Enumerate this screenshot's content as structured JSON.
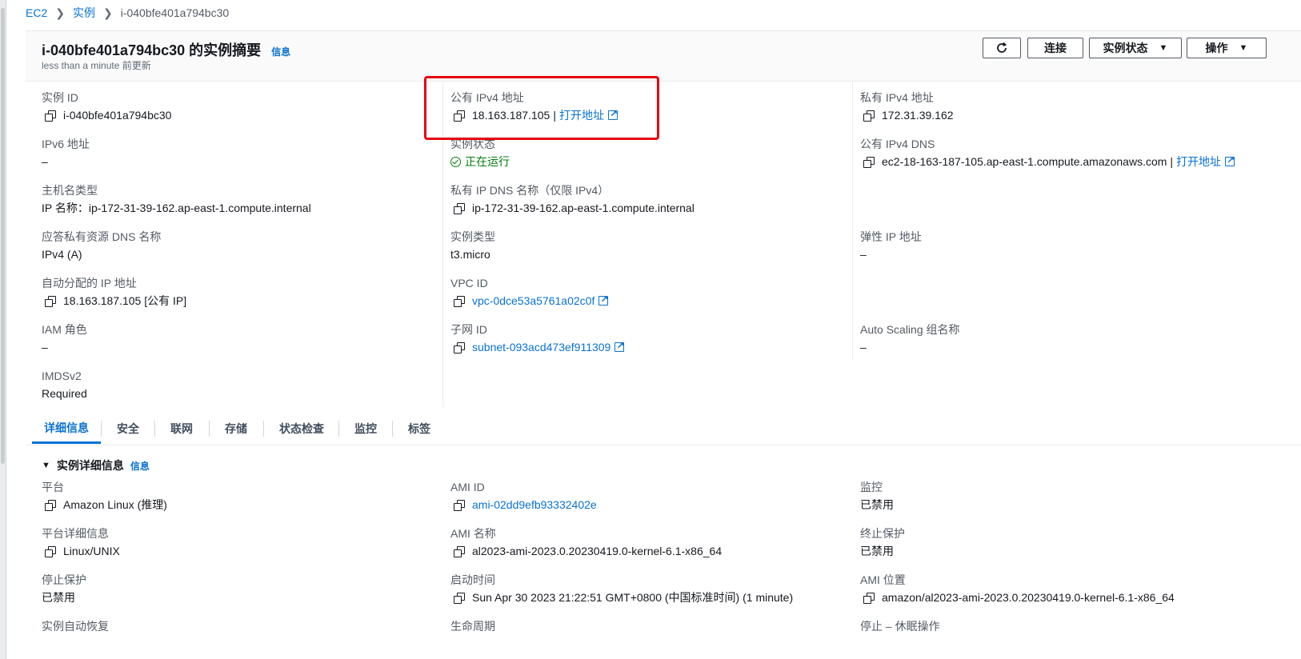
{
  "breadcrumb": {
    "ec2": "EC2",
    "instances": "实例",
    "current": "i-040bfe401a794bc30"
  },
  "summary": {
    "title": "i-040bfe401a794bc30 的实例摘要",
    "info": "信息",
    "updated": "less than a minute 前更新",
    "buttons": {
      "connect": "连接",
      "instance_state": "实例状态",
      "actions": "操作"
    }
  },
  "fields": {
    "instance_id": {
      "label": "实例 ID",
      "value": "i-040bfe401a794bc30"
    },
    "public_ipv4": {
      "label": "公有 IPv4 地址",
      "value": "18.163.187.105",
      "link": "打开地址"
    },
    "private_ipv4": {
      "label": "私有 IPv4 地址",
      "value": "172.31.39.162"
    },
    "ipv6": {
      "label": "IPv6 地址",
      "value": "–"
    },
    "instance_state": {
      "label": "实例状态",
      "value": "正在运行"
    },
    "public_dns": {
      "label": "公有 IPv4 DNS",
      "value": "ec2-18-163-187-105.ap-east-1.compute.amazonaws.com",
      "link": "打开地址"
    },
    "hostname_type": {
      "label": "主机名类型",
      "value": "IP 名称：ip-172-31-39-162.ap-east-1.compute.internal"
    },
    "private_dns": {
      "label": "私有 IP DNS 名称（仅限 IPv4）",
      "value": "ip-172-31-39-162.ap-east-1.compute.internal"
    },
    "answer_dns": {
      "label": "应答私有资源 DNS 名称",
      "value": "IPv4 (A)"
    },
    "instance_type": {
      "label": "实例类型",
      "value": "t3.micro"
    },
    "elastic_ip": {
      "label": "弹性 IP 地址",
      "value": "–"
    },
    "auto_ip": {
      "label": "自动分配的 IP 地址",
      "value": "18.163.187.105 [公有 IP]"
    },
    "vpc_id": {
      "label": "VPC ID",
      "value": "vpc-0dce53a5761a02c0f"
    },
    "iam_role": {
      "label": "IAM 角色",
      "value": "–"
    },
    "subnet_id": {
      "label": "子网 ID",
      "value": "subnet-093acd473ef911309"
    },
    "asg_name": {
      "label": "Auto Scaling 组名称",
      "value": "–"
    },
    "imdsv2": {
      "label": "IMDSv2",
      "value": "Required"
    }
  },
  "tabs": [
    "详细信息",
    "安全",
    "联网",
    "存储",
    "状态检查",
    "监控",
    "标签"
  ],
  "details": {
    "header": "实例详细信息",
    "info": "信息",
    "platform": {
      "label": "平台",
      "value": "Amazon Linux (推理)"
    },
    "ami_id": {
      "label": "AMI ID",
      "value": "ami-02dd9efb93332402e"
    },
    "monitoring": {
      "label": "监控",
      "value": "已禁用"
    },
    "platform_details": {
      "label": "平台详细信息",
      "value": "Linux/UNIX"
    },
    "ami_name": {
      "label": "AMI 名称",
      "value": "al2023-ami-2023.0.20230419.0-kernel-6.1-x86_64"
    },
    "termination_protection": {
      "label": "终止保护",
      "value": "已禁用"
    },
    "stop_protection": {
      "label": "停止保护",
      "value": "已禁用"
    },
    "launch_time": {
      "label": "启动时间",
      "value": "Sun Apr 30 2023 21:22:51 GMT+0800 (中国标准时间) (1 minute)"
    },
    "ami_location": {
      "label": "AMI 位置",
      "value": "amazon/al2023-ami-2023.0.20230419.0-kernel-6.1-x86_64"
    },
    "auto_recovery": {
      "label": "实例自动恢复"
    },
    "lifecycle": {
      "label": "生命周期"
    },
    "stop_hibernate": {
      "label": "停止 – 休眠操作"
    }
  },
  "colors": {
    "link": "#0972d3",
    "running": "#037f0c",
    "highlight": "#e60012"
  }
}
